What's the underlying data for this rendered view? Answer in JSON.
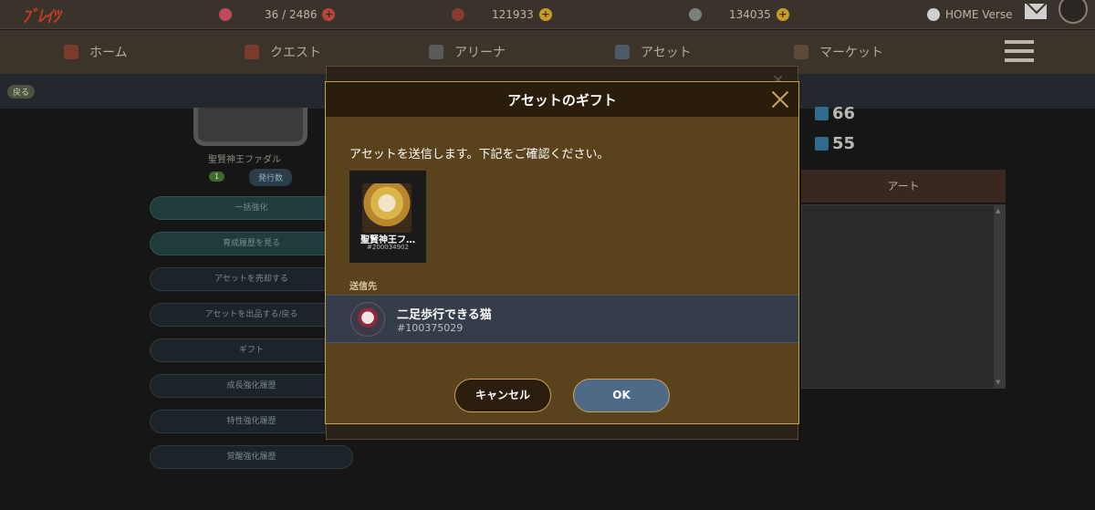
{
  "app": {
    "logo_text": "ﾌﾞﾚｲﾂ",
    "stats": [
      {
        "icon": "heart-icon",
        "value": "36 / 2486",
        "color": "#c0495a"
      },
      {
        "icon": "coin-icon",
        "value": "121933",
        "color": "#b8453a"
      },
      {
        "icon": "gem-icon",
        "value": "134035",
        "color": "#7a7f7a"
      }
    ],
    "account_label": "HOME Verse"
  },
  "nav": {
    "items": [
      {
        "label": "ホーム",
        "icon": "home-icon"
      },
      {
        "label": "クエスト",
        "icon": "quest-icon"
      },
      {
        "label": "アリーナ",
        "icon": "arena-icon"
      },
      {
        "label": "アセット",
        "icon": "asset-icon"
      },
      {
        "label": "マーケット",
        "icon": "market-icon"
      }
    ]
  },
  "background": {
    "back_label": "戻る",
    "card_name": "聖賢神王ファダル",
    "chip_green": "1",
    "chip_dark": "発行数",
    "side_buttons": [
      "一括強化",
      "育成履歴を見る",
      "アセットを売却する",
      "アセットを出品する/戻る",
      "ギフト",
      "成長強化履歴",
      "特性強化履歴",
      "覚醒強化履歴"
    ],
    "stat_values": [
      "66",
      "55"
    ],
    "art_tab": "アート"
  },
  "modal": {
    "title": "アセットのギフト",
    "message": "アセットを送信します。下記をご確認ください。",
    "asset": {
      "name": "聖賢神王フ…",
      "id": "#200034902"
    },
    "send_label": "送信先",
    "recipient": {
      "name": "二足歩行できる猫",
      "id": "#100375029"
    },
    "cancel_label": "キャンセル",
    "ok_label": "OK"
  }
}
